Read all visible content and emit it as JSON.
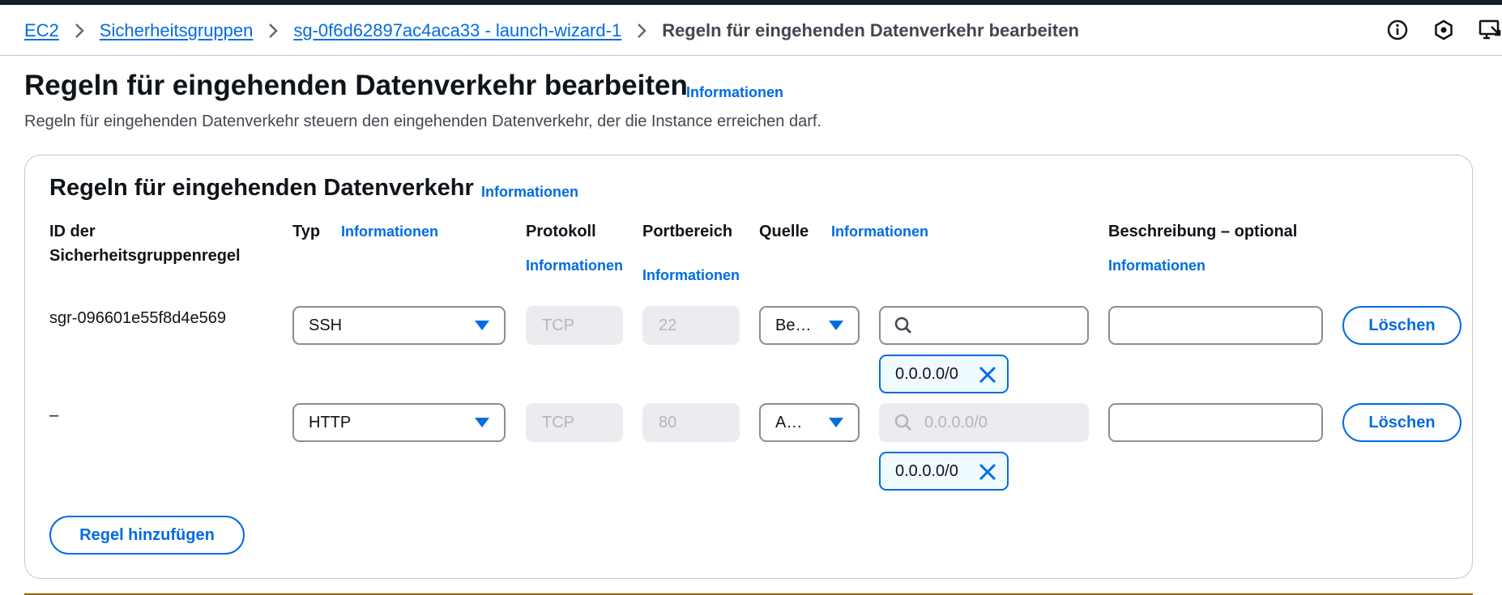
{
  "breadcrumb": {
    "items": [
      "EC2",
      "Sicherheitsgruppen",
      "sg-0f6d62897ac4aca33 - launch-wizard-1"
    ],
    "current": "Regeln für eingehenden Datenverkehr bearbeiten"
  },
  "header_icons": [
    "info-icon",
    "settings-icon",
    "feedback-icon"
  ],
  "page": {
    "title": "Regeln für eingehenden Datenverkehr bearbeiten",
    "title_info": "Informationen",
    "description": "Regeln für eingehenden Datenverkehr steuern den eingehenden Datenverkehr, der die Instance erreichen darf."
  },
  "panel": {
    "title": "Regeln für eingehenden Datenverkehr",
    "title_info": "Informationen",
    "columns": {
      "id_line1": "ID der",
      "id_line2": "Sicherheitsgruppenregel",
      "type": "Typ",
      "type_info": "Informationen",
      "protocol": "Protokoll",
      "protocol_info": "Informationen",
      "port": "Portbereich",
      "port_info": "Informationen",
      "source": "Quelle",
      "source_info": "Informationen",
      "description": "Beschreibung – optional",
      "description_info": "Informationen"
    },
    "rows": [
      {
        "id": "sgr-096601e55f8d4e569",
        "type": "SSH",
        "protocol": "TCP",
        "port": "22",
        "source_type": "Be…",
        "search_value": "",
        "search_placeholder": "",
        "token": "0.0.0.0/0",
        "description": "",
        "delete_label": "Löschen"
      },
      {
        "id": "–",
        "type": "HTTP",
        "protocol": "TCP",
        "port": "80",
        "source_type": "A…",
        "search_value": "",
        "search_placeholder": "0.0.0.0/0",
        "token": "0.0.0.0/0",
        "description": "",
        "delete_label": "Löschen"
      }
    ],
    "add_rule_label": "Regel hinzufügen"
  },
  "colors": {
    "link": "#006ce0",
    "text": "#0f141a",
    "muted": "#424650",
    "border": "#8c8c94",
    "disabled_bg": "#ebebf0",
    "token_bg": "#f0fbff",
    "top_bar": "#161d26"
  }
}
